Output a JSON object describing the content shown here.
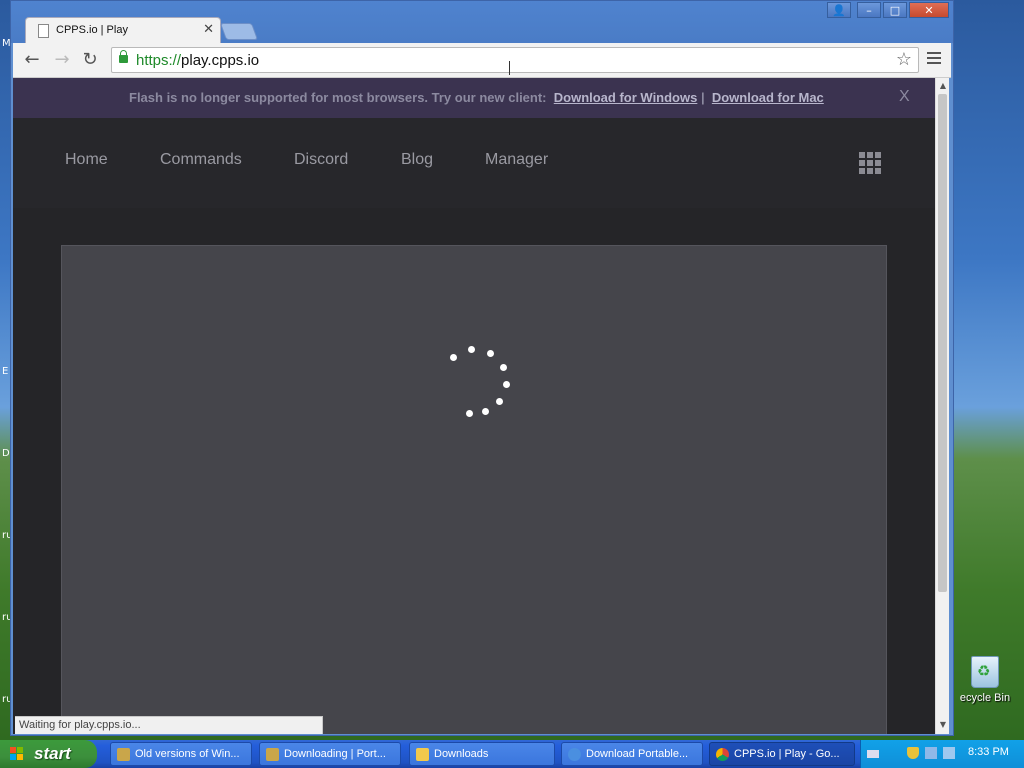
{
  "desktop": {
    "recycle_bin_label": "ecycle Bin",
    "edge_letters": [
      "M",
      "E",
      "D",
      "ru",
      "ru",
      "ru"
    ]
  },
  "browser": {
    "tab_title": "CPPS.io | Play",
    "url_scheme": "https://",
    "url_host": "play.cpps.io",
    "status_text": "Waiting for play.cpps.io..."
  },
  "banner": {
    "message": "Flash is no longer supported for most browsers. Try our new client:",
    "link_windows": "Download for Windows",
    "separator": "|",
    "link_mac": "Download for Mac",
    "close": "X"
  },
  "site_nav": {
    "items": [
      "Home",
      "Commands",
      "Discord",
      "Blog",
      "Manager"
    ]
  },
  "taskbar": {
    "start_label": "start",
    "tasks": [
      "Old versions of Win...",
      "Downloading | Port...",
      "Downloads",
      "Download Portable...",
      "CPPS.io | Play - Go..."
    ],
    "clock": "8:33 PM"
  },
  "colors": {
    "banner_bg": "#3b3350",
    "page_bg": "#252528",
    "game_bg": "#45454b",
    "url_scheme": "#1f8a2a",
    "xp_start_green": "#3c8f3c",
    "xp_taskbar_blue": "#245edb"
  }
}
